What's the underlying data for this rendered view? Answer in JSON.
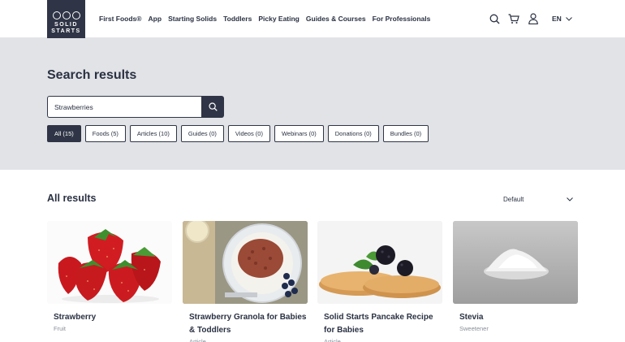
{
  "brand": {
    "line1": "SOLID",
    "line2": "STARTS"
  },
  "nav": [
    "First Foods®",
    "App",
    "Starting Solids",
    "Toddlers",
    "Picky Eating",
    "Guides & Courses",
    "For Professionals"
  ],
  "header_icons": [
    "search-icon",
    "cart-icon",
    "user-icon"
  ],
  "language": "EN",
  "search": {
    "title": "Search results",
    "value": "Strawberries"
  },
  "filters": [
    {
      "label": "All (15)",
      "active": true
    },
    {
      "label": "Foods (5)",
      "active": false
    },
    {
      "label": "Articles (10)",
      "active": false
    },
    {
      "label": "Guides (0)",
      "active": false
    },
    {
      "label": "Videos (0)",
      "active": false
    },
    {
      "label": "Webinars (0)",
      "active": false
    },
    {
      "label": "Donations (0)",
      "active": false
    },
    {
      "label": "Bundles (0)",
      "active": false
    }
  ],
  "results": {
    "title": "All results",
    "sort": "Default",
    "cards": [
      {
        "title": "Strawberry",
        "type": "Fruit"
      },
      {
        "title": "Strawberry Granola for Babies & Toddlers",
        "type": "Article"
      },
      {
        "title": "Solid Starts Pancake Recipe for Babies",
        "type": "Article"
      },
      {
        "title": "Stevia",
        "type": "Sweetener"
      }
    ]
  },
  "colors": {
    "navy": "#2f3546",
    "band": "#e1e3e7",
    "muted": "#8a8f9a"
  }
}
